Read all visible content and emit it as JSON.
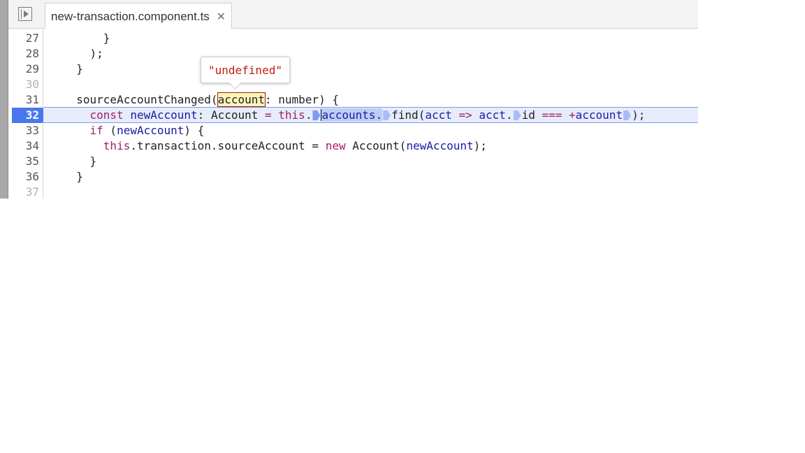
{
  "tab": {
    "label": "new-transaction.component.ts",
    "close_glyph": "✕"
  },
  "icons": {
    "nav_toggle": "navigator-toggle-icon",
    "close": "close-icon"
  },
  "colors": {
    "execution_marker": "#4a78ec",
    "execution_line_bg": "#e6ecfb",
    "tooltip_value": "#c41a16"
  },
  "line_numbers": [
    "27",
    "28",
    "29",
    "30",
    "31",
    "32",
    "33",
    "34",
    "35",
    "36",
    "37"
  ],
  "current_line": "32",
  "tooltip": {
    "value": "\"undefined\""
  },
  "code": {
    "l27": "      }",
    "l28": "    );",
    "l29": "  }",
    "l31": {
      "pre": "  sourceAccountChanged(",
      "param": "account",
      "colon": ": ",
      "type": "number",
      "post": ") {"
    },
    "l32": {
      "indent": "    ",
      "kw_const": "const",
      "sp1": " ",
      "var_new": "newAccount",
      "colon": ": ",
      "type": "Account",
      "eq": " = ",
      "kw_this": "this",
      "dot1": ".",
      "prop_accounts": "accounts",
      "dot2": ".",
      "method_find": "find",
      "open": "(",
      "arg_acct": "acct",
      "arrow": " => ",
      "acct2": "acct",
      "dot3": ".",
      "prop_id": "id",
      "strict_eq": " === ",
      "plus": "+",
      "var_account": "account",
      "close": ");"
    },
    "l33": {
      "indent": "    ",
      "kw_if": "if",
      "rest_open": " (",
      "var": "newAccount",
      "rest_close": ") {"
    },
    "l34": {
      "indent": "      ",
      "kw_this": "this",
      "mid": ".transaction.sourceAccount = ",
      "kw_new": "new",
      "sp": " ",
      "cls": "Account",
      "open": "(",
      "var": "newAccount",
      "close": ");"
    },
    "l35": "    }",
    "l36": "  }"
  }
}
